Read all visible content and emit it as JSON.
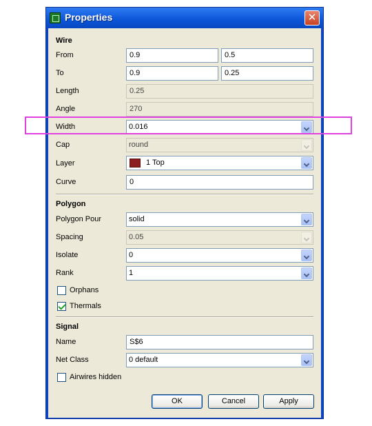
{
  "window": {
    "title": "Properties",
    "close_glyph": "✕"
  },
  "wire": {
    "section": "Wire",
    "from": {
      "label": "From",
      "x": "0.9",
      "y": "0.5"
    },
    "to": {
      "label": "To",
      "x": "0.9",
      "y": "0.25"
    },
    "length": {
      "label": "Length",
      "value": "0.25"
    },
    "angle": {
      "label": "Angle",
      "value": "270"
    },
    "width": {
      "label": "Width",
      "value": "0.016"
    },
    "cap": {
      "label": "Cap",
      "value": "round"
    },
    "layer": {
      "label": "Layer",
      "value": "1 Top",
      "color": "#8b1f1f"
    },
    "curve": {
      "label": "Curve",
      "value": "0"
    }
  },
  "polygon": {
    "section": "Polygon",
    "pour": {
      "label": "Polygon Pour",
      "value": "solid"
    },
    "spacing": {
      "label": "Spacing",
      "value": "0.05"
    },
    "isolate": {
      "label": "Isolate",
      "value": "0"
    },
    "rank": {
      "label": "Rank",
      "value": "1"
    },
    "orphans": {
      "label": "Orphans",
      "checked": false
    },
    "thermals": {
      "label": "Thermals",
      "checked": true
    }
  },
  "signal": {
    "section": "Signal",
    "name": {
      "label": "Name",
      "value": "S$6"
    },
    "net_class": {
      "label": "Net Class",
      "value": "0 default"
    },
    "airwires_hidden": {
      "label": "Airwires hidden",
      "checked": false
    }
  },
  "buttons": {
    "ok": "OK",
    "cancel": "Cancel",
    "apply": "Apply"
  },
  "colors": {
    "title_bar": "#0b55d8",
    "dialog_bg": "#ece9d8",
    "highlight": "#e040e0"
  }
}
